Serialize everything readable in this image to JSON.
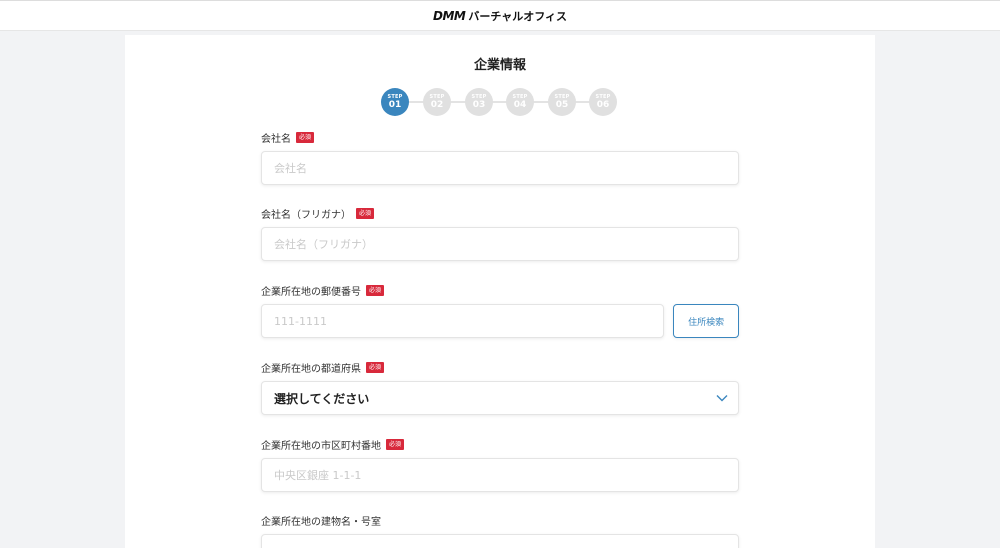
{
  "header": {
    "logo_brand": "DMM",
    "logo_text": "バーチャルオフィス"
  },
  "page": {
    "title": "企業情報"
  },
  "steps": [
    {
      "label": "STEP",
      "num": "01",
      "active": true
    },
    {
      "label": "STEP",
      "num": "02",
      "active": false
    },
    {
      "label": "STEP",
      "num": "03",
      "active": false
    },
    {
      "label": "STEP",
      "num": "04",
      "active": false
    },
    {
      "label": "STEP",
      "num": "05",
      "active": false
    },
    {
      "label": "STEP",
      "num": "06",
      "active": false
    }
  ],
  "required_badge": "必須",
  "fields": {
    "company_name": {
      "label": "会社名",
      "placeholder": "会社名"
    },
    "company_kana": {
      "label": "会社名（フリガナ）",
      "placeholder": "会社名（フリガナ）"
    },
    "postal_code": {
      "label": "企業所在地の郵便番号",
      "placeholder": "111-1111",
      "button": "住所検索"
    },
    "prefecture": {
      "label": "企業所在地の都道府県",
      "value": "選択してください"
    },
    "city": {
      "label": "企業所在地の市区町村番地",
      "placeholder": "中央区銀座 1-1-1"
    },
    "building": {
      "label": "企業所在地の建物名・号室"
    }
  }
}
